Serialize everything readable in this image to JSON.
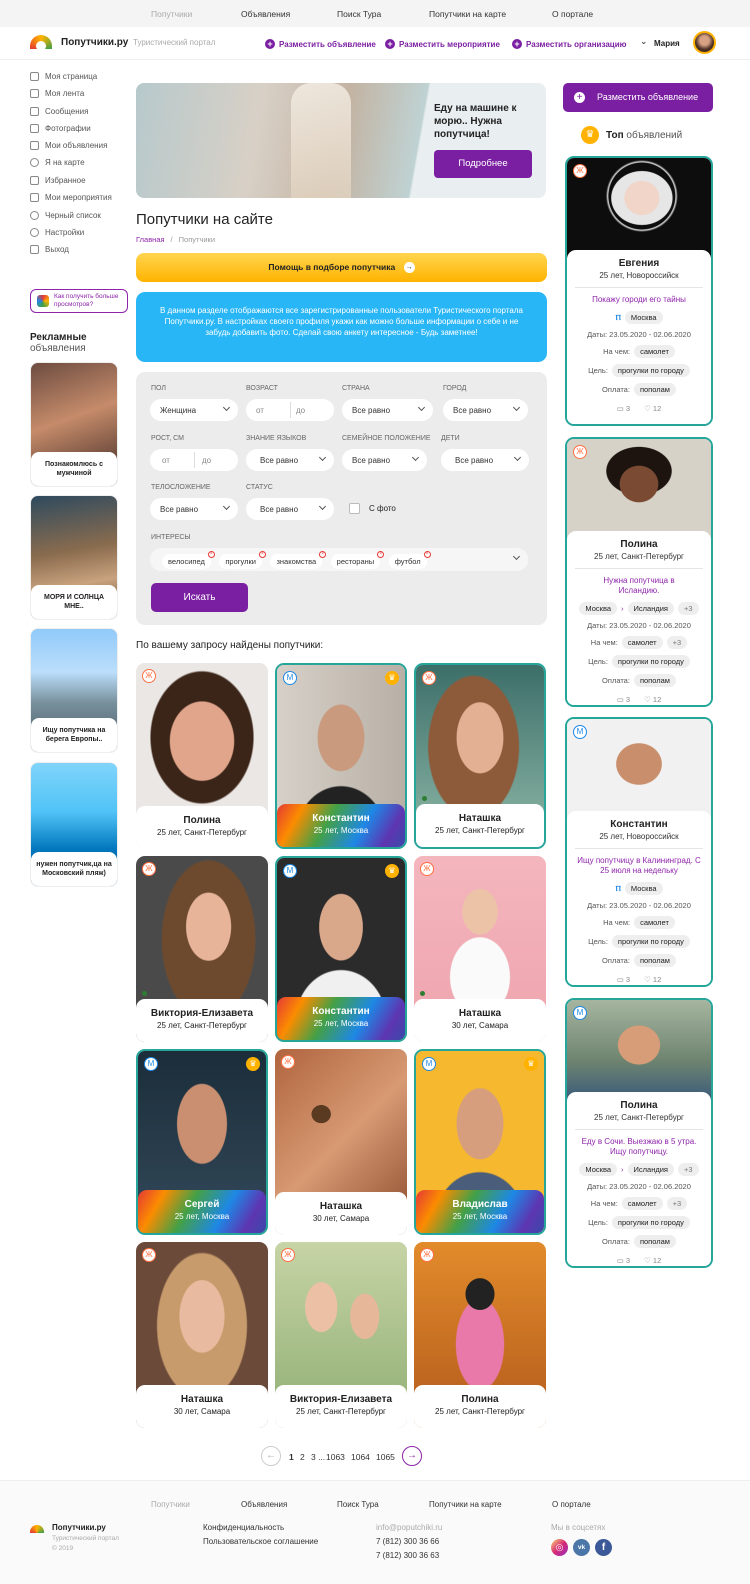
{
  "topnav": [
    "Попутчики",
    "Объявления",
    "Поиск Тура",
    "Попутчики на карте",
    "О портале"
  ],
  "header": {
    "brand": "Попутчики.ру",
    "tagline": "Туристический портал",
    "actions": [
      "Разместить объявление",
      "Разместить мероприятие",
      "Разместить организацию"
    ],
    "user": "Мария"
  },
  "sidebar": {
    "items": [
      "Моя страница",
      "Моя лента",
      "Сообщения",
      "Фотографии",
      "Мои объявления",
      "Я на карте",
      "Избранное",
      "Мои мероприятия",
      "Черный список",
      "Настройки",
      "Выход"
    ],
    "promo": "Как получить больше просмотров?",
    "ads_title": "Рекламные",
    "ads_subtitle": "объявления",
    "ads": [
      "Познакомлюсь с мужчиной",
      "МОРЯ И СОЛНЦА МНЕ..",
      "Ищу попутчика на берега Европы..",
      "нужен попутчик,ца на Московский пляж)"
    ]
  },
  "banner": {
    "text": "Еду на машине к морю.. Нужна попутчица!",
    "button": "Подробнее"
  },
  "page": {
    "title": "Попутчики на сайте",
    "breadcrumb_home": "Главная",
    "breadcrumb_sep": "/",
    "breadcrumb_current": "Попутчики",
    "help_button": "Помощь в подборе попутчика",
    "info": "В данном разделе отображаются все зарегистрированные пользователи Туристического портала Попутчики.ру. В настройках своего профиля укажи как можно больше информации о себе и не забудь добавить фото. Сделай свою анкету интересное - Будь заметнее!",
    "results_title": "По вашему запросу найдены попутчики:"
  },
  "filters": {
    "labels": {
      "gender": "ПОЛ",
      "age": "ВОЗРАСТ",
      "country": "СТРАНА",
      "city": "ГОРОД",
      "height": "РОСТ, СМ",
      "languages": "ЗНАНИЕ ЯЗЫКОВ",
      "marital": "СЕМЕЙНОЕ ПОЛОЖЕНИЕ",
      "children": "ДЕТИ",
      "body": "ТЕЛОСЛОЖЕНИЕ",
      "status": "СТАТУС",
      "interests": "ИНТЕРЕСЫ"
    },
    "gender": "Женщина",
    "from": "от",
    "to": "до",
    "any": "Все равно",
    "photo_only": "С фото",
    "interests": [
      "велосипед",
      "прогулки",
      "знакомства",
      "рестораны",
      "футбол"
    ],
    "search": "Искать"
  },
  "people": [
    {
      "name": "Полина",
      "meta": "25 лет, Санкт-Петербург",
      "badge": "Ж"
    },
    {
      "name": "Константин",
      "meta": "25 лет, Москва",
      "badge": "М"
    },
    {
      "name": "Наташка",
      "meta": "25 лет, Санкт-Петербург",
      "badge": "Ж"
    },
    {
      "name": "Виктория-Елизавета",
      "meta": "25 лет, Санкт-Петербург",
      "badge": "Ж"
    },
    {
      "name": "Константин",
      "meta": "25 лет, Москва",
      "badge": "М"
    },
    {
      "name": "Наташка",
      "meta": "30 лет, Самара",
      "badge": "Ж"
    },
    {
      "name": "Сергей",
      "meta": "25 лет, Москва",
      "badge": "М"
    },
    {
      "name": "Наташка",
      "meta": "30 лет, Самара",
      "badge": "Ж"
    },
    {
      "name": "Владислав",
      "meta": "25 лет, Москва",
      "badge": "М"
    },
    {
      "name": "Наташка",
      "meta": "30 лет, Самара",
      "badge": "Ж"
    },
    {
      "name": "Виктория-Елизавета",
      "meta": "25 лет, Санкт-Петербург",
      "badge": "Ж"
    },
    {
      "name": "Полина",
      "meta": "25 лет, Санкт-Петербург",
      "badge": "Ж"
    }
  ],
  "pagination": [
    "1",
    "2",
    "3 ...",
    "1063",
    "1064",
    "1065"
  ],
  "right": {
    "button": "Разместить объявление",
    "top_bold": "Топ",
    "top_rest": "объявлений",
    "cards": [
      {
        "name": "Евгения",
        "meta": "25 лет, Новороссийск",
        "badge": "Ж",
        "quote": "Покажу городи его тайны",
        "from": "Москва",
        "to": "",
        "extra": "",
        "dates": "Даты: 23.05.2020 - 02.06.2020",
        "on": "На чем:",
        "on_val": "самолет",
        "goal": "Цель:",
        "goal_val": "прогулки по городу",
        "pay": "Оплата:",
        "pay_val": "пополам",
        "comments": "3",
        "likes": "12"
      },
      {
        "name": "Полина",
        "meta": "25 лет, Санкт-Петербург",
        "badge": "Ж",
        "quote": "Нужна попутчица в Исландию.",
        "from": "Москва",
        "to": "Исландия",
        "extra": "+3",
        "dates": "Даты: 23.05.2020 - 02.06.2020",
        "on": "На чем:",
        "on_val": "самолет",
        "goal": "Цель:",
        "goal_val": "прогулки по городу",
        "pay": "Оплата:",
        "pay_val": "пополам",
        "comments": "3",
        "likes": "12"
      },
      {
        "name": "Константин",
        "meta": "25 лет, Новороссийск",
        "badge": "М",
        "quote": "Ищу попутчицу в Калининград. С 25 июля на недельку",
        "from": "Москва",
        "to": "",
        "extra": "",
        "dates": "Даты: 23.05.2020 - 02.06.2020",
        "on": "На чем:",
        "on_val": "самолет",
        "goal": "Цель:",
        "goal_val": "прогулки по городу",
        "pay": "Оплата:",
        "pay_val": "пополам",
        "comments": "3",
        "likes": "12"
      },
      {
        "name": "Полина",
        "meta": "25 лет, Санкт-Петербург",
        "badge": "М",
        "quote": "Еду в Сочи. Выезжаю в 5 утра. Ищу попутчицу.",
        "from": "Москва",
        "to": "Исландия",
        "extra": "+3",
        "dates": "Даты: 23.05.2020 - 02.06.2020",
        "on": "На чем:",
        "on_val": "самолет",
        "goal": "Цель:",
        "goal_val": "прогулки по городу",
        "pay": "Оплата:",
        "pay_val": "пополам",
        "comments": "3",
        "likes": "12"
      }
    ]
  },
  "footer": {
    "nav": [
      "Попутчики",
      "Объявления",
      "Поиск Тура",
      "Попутчики на карте",
      "О портале"
    ],
    "brand": "Попутчики.ру",
    "tagline": "Туристический портал",
    "copy": "© 2019",
    "links": [
      "Конфиденциальность",
      "Пользовательское соглашение"
    ],
    "email": "info@poputchiki.ru",
    "phones": [
      "7 (812) 300 36 66",
      "7 (812) 300 36 63"
    ],
    "social_title": "Мы в соцсетях"
  }
}
